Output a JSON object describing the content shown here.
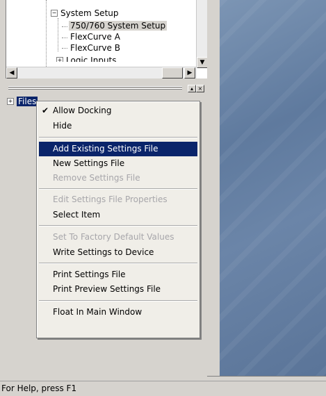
{
  "tree": {
    "system_setup": "System Setup",
    "setup_750_760": "750/760 System Setup",
    "flexcurve_a": "FlexCurve A",
    "flexcurve_b": "FlexCurve B",
    "logic_inputs": "Logic Inputs"
  },
  "files_panel": {
    "root_label": "Files",
    "expander": "+"
  },
  "context_menu": {
    "items": [
      {
        "label": "Allow Docking",
        "checked": true,
        "enabled": true
      },
      {
        "label": "Hide",
        "enabled": true
      },
      {
        "label": "Add Existing Settings File",
        "enabled": true,
        "highlighted": true
      },
      {
        "label": "New Settings File",
        "enabled": true
      },
      {
        "label": "Remove Settings File",
        "enabled": false
      },
      {
        "label": "Edit Settings File Properties",
        "enabled": false
      },
      {
        "label": "Select Item",
        "enabled": true
      },
      {
        "label": "Set To Factory Default Values",
        "enabled": false
      },
      {
        "label": "Write Settings to Device",
        "enabled": true
      },
      {
        "label": "Print Settings File",
        "enabled": true
      },
      {
        "label": "Print Preview Settings File",
        "enabled": true
      },
      {
        "label": "Float In Main Window",
        "enabled": true
      }
    ]
  },
  "statusbar": {
    "text": "For Help, press F1"
  },
  "icons": {
    "check": "checkmark-icon",
    "arrow_up": "arrow-up-icon",
    "arrow_down": "arrow-down-icon",
    "arrow_left": "arrow-left-icon",
    "arrow_right": "arrow-right-icon"
  },
  "colors": {
    "highlight": "#0a246a",
    "workspace": "#6b85a8",
    "chrome": "#d6d3ce",
    "disabled_text": "#a7a6aa"
  }
}
